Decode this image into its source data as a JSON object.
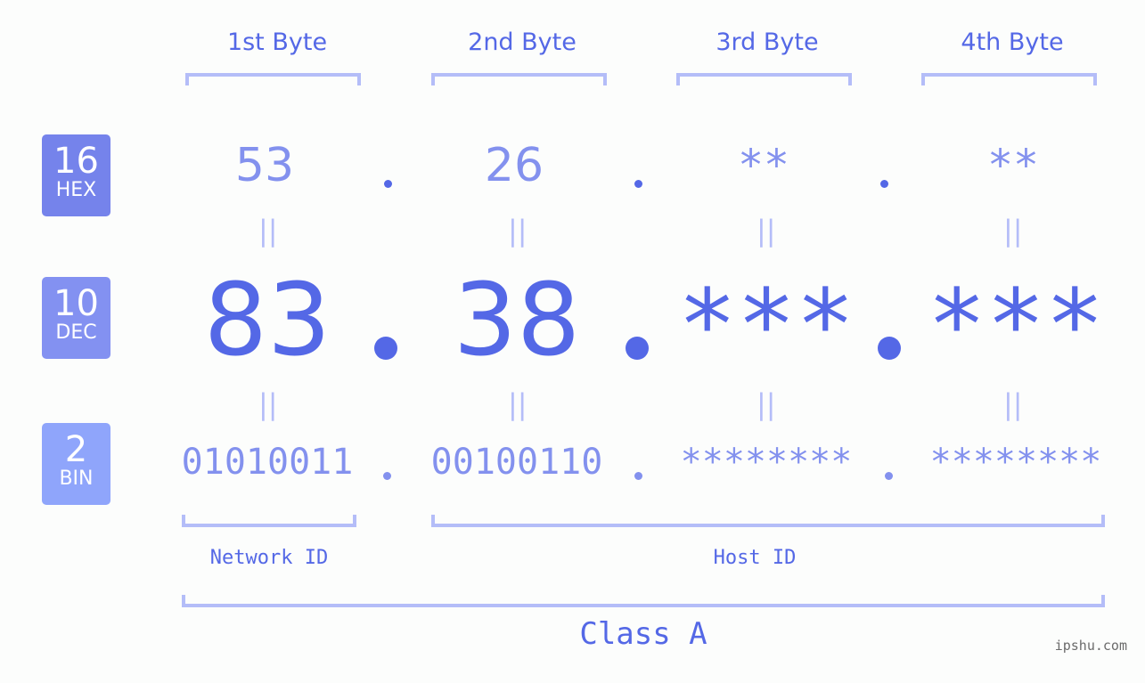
{
  "headers": [
    "1st Byte",
    "2nd Byte",
    "3rd Byte",
    "4th Byte"
  ],
  "badges": {
    "hex": {
      "num": "16",
      "label": "HEX",
      "color": "#7583eb"
    },
    "dec": {
      "num": "10",
      "label": "DEC",
      "color": "#8391f1"
    },
    "bin": {
      "num": "2",
      "label": "BIN",
      "color": "#8fa5fb"
    }
  },
  "hex": [
    "53",
    "26",
    "**",
    "**"
  ],
  "dec": [
    "83",
    "38",
    "***",
    "***"
  ],
  "bin": [
    "01010011",
    "00100110",
    "********",
    "********"
  ],
  "separator": ".",
  "equals": "||",
  "labels": {
    "network": "Network ID",
    "host": "Host ID",
    "class": "Class A"
  },
  "watermark": "ipshu.com",
  "colors": {
    "primary": "#5468e6",
    "secondary": "#8391ee",
    "bracket": "#b4bdf8"
  }
}
